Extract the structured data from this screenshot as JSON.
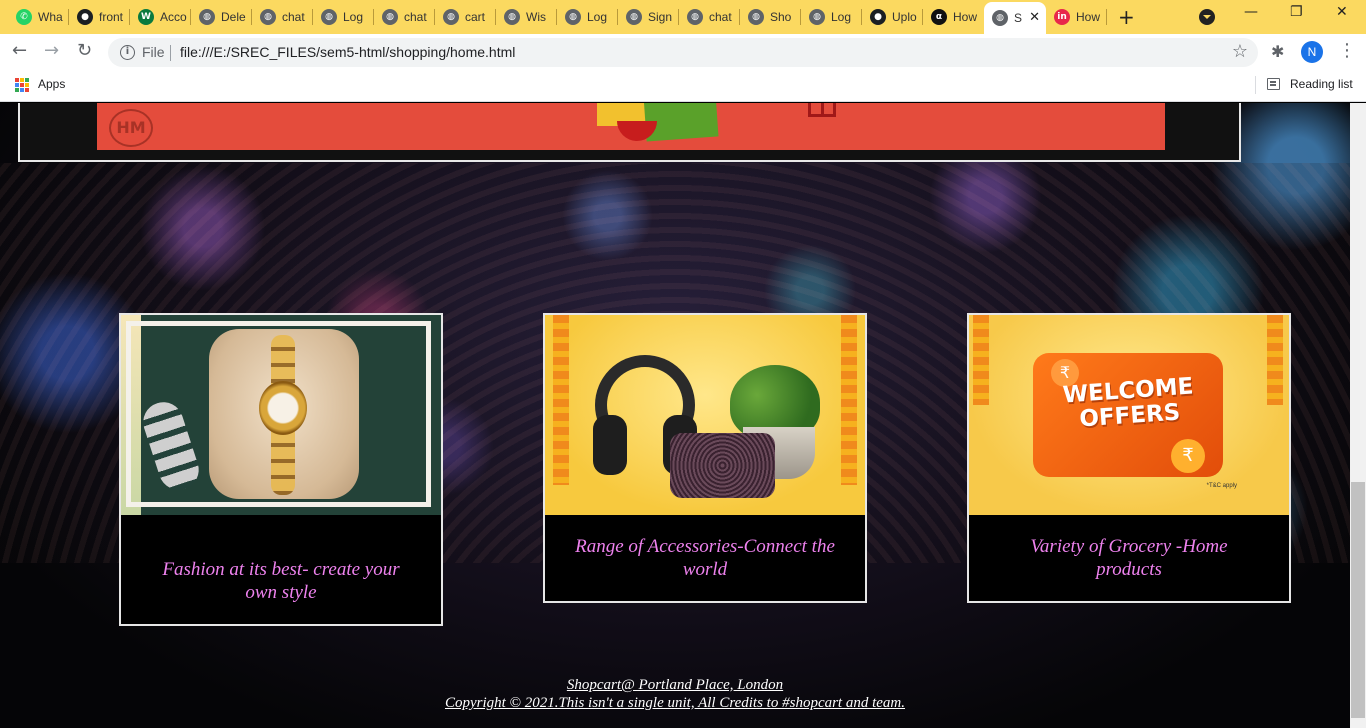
{
  "browser": {
    "tabs": [
      {
        "label": "Wha",
        "icon": "whatsapp-icon",
        "color": "#25d366"
      },
      {
        "label": "front",
        "icon": "github-icon",
        "color": "#1b1f23"
      },
      {
        "label": "Acco",
        "icon": "wix-icon",
        "color": "#0a7a3e"
      },
      {
        "label": "Dele",
        "icon": "globe-icon",
        "color": "#5f6368"
      },
      {
        "label": "chat",
        "icon": "globe-icon",
        "color": "#5f6368"
      },
      {
        "label": "Log",
        "icon": "globe-icon",
        "color": "#5f6368"
      },
      {
        "label": "chat",
        "icon": "globe-icon",
        "color": "#5f6368"
      },
      {
        "label": "cart",
        "icon": "globe-icon",
        "color": "#5f6368"
      },
      {
        "label": "Wis",
        "icon": "globe-icon",
        "color": "#5f6368"
      },
      {
        "label": "Log",
        "icon": "globe-icon",
        "color": "#5f6368"
      },
      {
        "label": "Sign",
        "icon": "globe-icon",
        "color": "#5f6368"
      },
      {
        "label": "chat",
        "icon": "globe-icon",
        "color": "#5f6368"
      },
      {
        "label": "Sho",
        "icon": "globe-icon",
        "color": "#5f6368"
      },
      {
        "label": "Log",
        "icon": "globe-icon",
        "color": "#5f6368"
      },
      {
        "label": "Uplo",
        "icon": "github-icon",
        "color": "#1b1f23"
      },
      {
        "label": "How",
        "icon": "alpha-icon",
        "color": "#111111"
      },
      {
        "label": "S",
        "icon": "globe-icon",
        "color": "#5f6368",
        "active": true
      },
      {
        "label": "How",
        "icon": "invision-icon",
        "color": "#e8274b"
      }
    ],
    "new_tab_symbol": "+",
    "window_controls": {
      "minimize": "—",
      "maximize": "❐",
      "close": "✕"
    },
    "toolbar": {
      "back": "←",
      "forward": "→",
      "reload": "↻",
      "site_chip": "File",
      "url": "file:///E:/SREC_FILES/sem5-html/shopping/home.html",
      "profile_initial": "N",
      "bookmark_star": "☆",
      "extensions": "✱",
      "menu": "⋮"
    },
    "bookmarks": {
      "apps_label": "Apps",
      "reading_list_label": "Reading list"
    },
    "theme_color": "#fbd960"
  },
  "page": {
    "banner": {
      "logo_text": "HM",
      "color": "#e44c3c"
    },
    "cards": [
      {
        "caption": "Fashion at its best- create your own style",
        "image": "gold-watch-on-pillow"
      },
      {
        "caption": "Range of Accessories-Connect the world",
        "image": "headphones-clutch-plant"
      },
      {
        "caption": "Variety of Grocery -Home products",
        "image": "welcome-offers-ticket",
        "offer_text": "WELCOME OFFERS",
        "rupee": "₹",
        "tnc": "*T&C apply"
      }
    ],
    "caption_color": "#ee82ee",
    "footer": {
      "line1": "Shopcart@ Portland Place, London",
      "line2": "Copyright © 2021.This isn't a single unit, All Credits to #shopcart and team."
    }
  }
}
